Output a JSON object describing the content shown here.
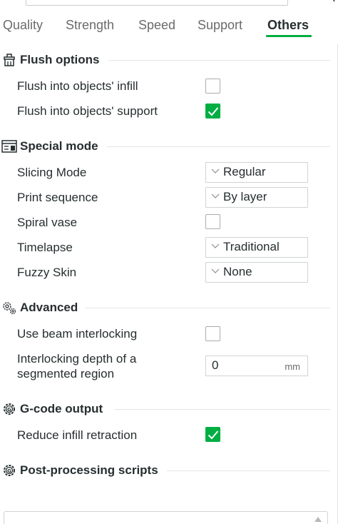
{
  "tabs": [
    {
      "label": "Quality",
      "active": false
    },
    {
      "label": "Strength",
      "active": false
    },
    {
      "label": "Speed",
      "active": false
    },
    {
      "label": "Support",
      "active": false
    },
    {
      "label": "Others",
      "active": true
    }
  ],
  "accent_color": "#00ae42",
  "sections": {
    "flush": {
      "title": "Flush options",
      "icon": "brush-icon",
      "rows": [
        {
          "label": "Flush into objects' infill",
          "checked": false
        },
        {
          "label": "Flush into objects' support",
          "checked": true
        }
      ]
    },
    "special": {
      "title": "Special mode",
      "icon": "special-mode-icon",
      "slicing_mode": {
        "label": "Slicing Mode",
        "value": "Regular"
      },
      "print_sequence": {
        "label": "Print sequence",
        "value": "By layer"
      },
      "spiral_vase": {
        "label": "Spiral vase",
        "checked": false
      },
      "timelapse": {
        "label": "Timelapse",
        "value": "Traditional"
      },
      "fuzzy_skin": {
        "label": "Fuzzy Skin",
        "value": "None"
      }
    },
    "advanced": {
      "title": "Advanced",
      "icon": "gears-icon",
      "beam_interlocking": {
        "label": "Use beam interlocking",
        "checked": false
      },
      "interlocking_depth": {
        "label_line1": "Interlocking depth of a",
        "label_line2": "segmented region",
        "value": "0",
        "unit": "mm"
      }
    },
    "gcode": {
      "title": "G-code output",
      "icon": "gear-icon",
      "reduce_retraction": {
        "label": "Reduce infill retraction",
        "checked": true
      }
    },
    "post": {
      "title": "Post-processing scripts",
      "icon": "gear-icon"
    }
  }
}
